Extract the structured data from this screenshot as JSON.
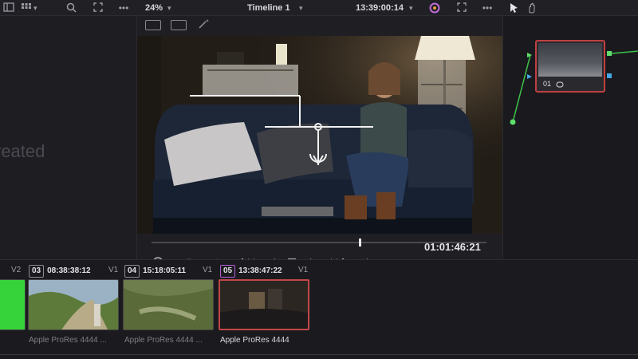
{
  "toolbar": {
    "zoom": "24%",
    "timeline_name": "Timeline 1",
    "source_timecode": "13:39:00:14",
    "icons": [
      "panel-toggle-icon",
      "grid-icon",
      "search-icon",
      "expand-icon",
      "more-icon",
      "chevron-down-icon",
      "color-wheel-icon",
      "fullscreen-icon",
      "pointer-icon",
      "hand-icon"
    ]
  },
  "left_panel": {
    "status_text": "reated"
  },
  "viewer": {
    "timecode": "01:01:46:21",
    "progress": 0.62
  },
  "nodes": [
    {
      "label": "01"
    }
  ],
  "timeline": {
    "clips": [
      {
        "number": "",
        "timecode": "",
        "track": "V2",
        "codec": "",
        "color": "#36d43a"
      },
      {
        "number": "03",
        "timecode": "08:38:38:12",
        "track": "V1",
        "codec": "Apple ProRes 4444 ...",
        "color": "#5a7a3a",
        "active": false
      },
      {
        "number": "04",
        "timecode": "15:18:05:11",
        "track": "V1",
        "codec": "Apple ProRes 4444 ...",
        "color": "#5e6e40",
        "active": false
      },
      {
        "number": "05",
        "timecode": "13:38:47:22",
        "track": "V1",
        "codec": "Apple ProRes 4444",
        "color": "#3a3430",
        "active": true
      }
    ]
  }
}
